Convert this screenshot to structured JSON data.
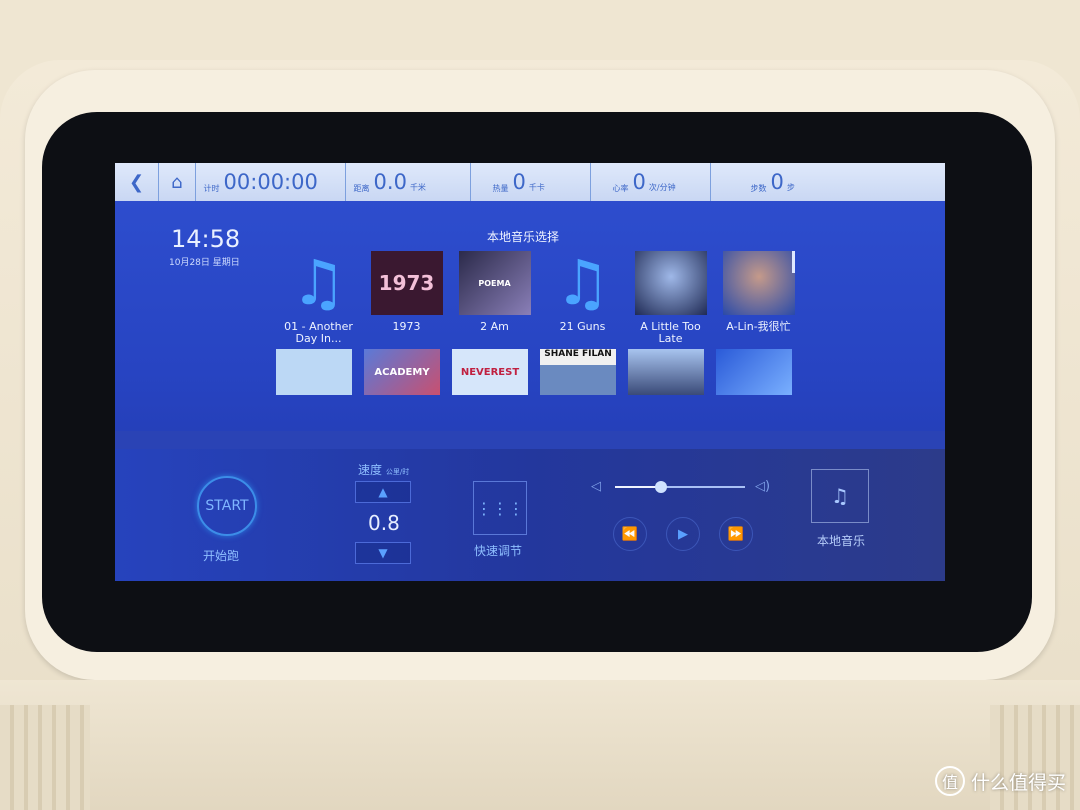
{
  "topbar": {
    "timer": {
      "label": "计时",
      "value": "00:00:00"
    },
    "distance": {
      "label": "距离",
      "value": "0.0",
      "unit": "千米"
    },
    "calories": {
      "label": "热量",
      "value": "0",
      "unit": "千卡"
    },
    "heart_rate": {
      "label": "心率",
      "value": "0",
      "unit": "次/分钟"
    },
    "steps": {
      "label": "步数",
      "value": "0",
      "unit": "步"
    }
  },
  "clock": {
    "time": "14:58",
    "date": "10月28日 星期日"
  },
  "music": {
    "title": "本地音乐选择",
    "items": [
      {
        "name": "01 - Another Day In...",
        "cover": "note-icon"
      },
      {
        "name": "1973",
        "cover_text": "1973"
      },
      {
        "name": "2 Am",
        "cover_text": "POEMA"
      },
      {
        "name": "21 Guns",
        "cover": "note-icon"
      },
      {
        "name": "A Little Too Late",
        "cover_text": ""
      },
      {
        "name": "A-Lin-我很忙",
        "cover_text": ""
      }
    ],
    "row2_covers": [
      "",
      "ACADEMY",
      "NEVEREST",
      "SHANE FILAN",
      "",
      ""
    ]
  },
  "controls": {
    "start_label": "START",
    "start_caption": "开始跑",
    "speed_label": "速度",
    "speed_unit": "公里/时",
    "speed_value": "0.8",
    "quick_adjust": "快速调节",
    "volume_level": 0.35,
    "local_music": "本地音乐"
  },
  "watermark": {
    "text": "什么值得买",
    "logo": "值"
  }
}
